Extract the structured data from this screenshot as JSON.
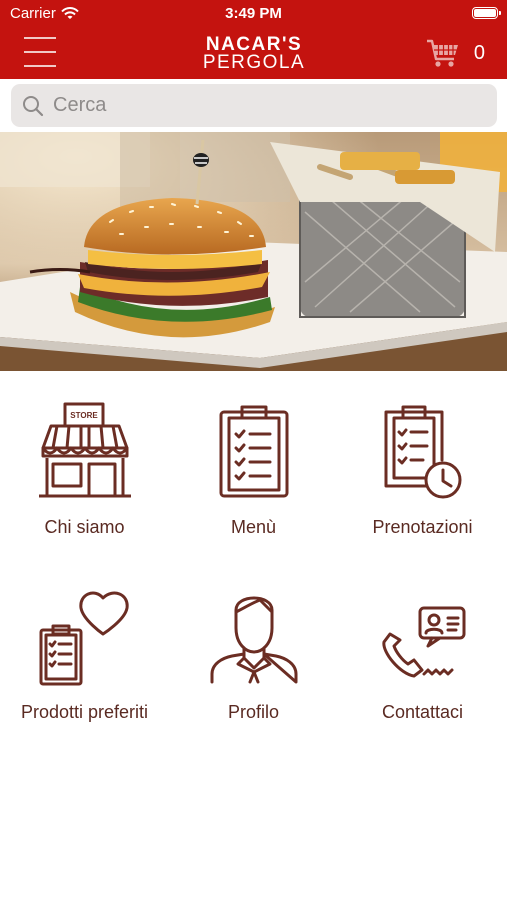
{
  "status_bar": {
    "carrier": "Carrier",
    "time": "3:49 PM"
  },
  "header": {
    "logo_line1": "NACAR'S",
    "logo_line2": "PERGOLA",
    "cart_count": "0"
  },
  "search": {
    "placeholder": "Cerca"
  },
  "menu": [
    {
      "label": "Chi siamo",
      "icon": "store-icon",
      "store_sign": "STORE"
    },
    {
      "label": "Menù",
      "icon": "clipboard-list-icon"
    },
    {
      "label": "Prenotazioni",
      "icon": "clipboard-clock-icon"
    },
    {
      "label": "Prodotti preferiti",
      "icon": "clipboard-heart-icon"
    },
    {
      "label": "Profilo",
      "icon": "user-icon"
    },
    {
      "label": "Contattaci",
      "icon": "phone-contact-icon"
    }
  ],
  "colors": {
    "brand_red": "#c4130f",
    "icon_brown": "#6b2d23"
  }
}
